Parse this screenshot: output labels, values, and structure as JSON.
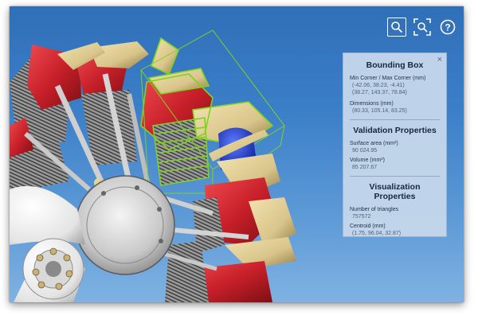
{
  "toolbar": {
    "buttons": [
      {
        "name": "zoom-window-button",
        "icon": "magnifier-icon"
      },
      {
        "name": "zoom-fit-button",
        "icon": "zoom-extents-icon"
      },
      {
        "name": "help-button",
        "icon": "question-mark-icon"
      }
    ]
  },
  "panel": {
    "close_icon": "×",
    "bounding_box": {
      "title": "Bounding Box",
      "min_max_label": "Min Corner / Max Corner (mm)",
      "min_corner": "(-42.06, 38.23, -4.41)",
      "max_corner": "(38.27, 143.37, 78.84)",
      "dimensions_label": "Dimensions (mm)",
      "dimensions": "(80.33, 105.14, 83.25)"
    },
    "validation": {
      "title": "Validation Properties",
      "surface_label": "Surface area (mm²)",
      "surface_value": "90 024.95",
      "volume_label": "Volume (mm³)",
      "volume_value": "85 207.67"
    },
    "visualization": {
      "title": "Visualization Properties",
      "triangles_label": "Number of triangles",
      "triangles_value": "757572",
      "centroid_label": "Centroid (mm)",
      "centroid_value": "(1.75, 96.04, 32.87)"
    }
  },
  "colors": {
    "background_top": "#2f6fb8",
    "background_bottom": "#7fb2e2",
    "cylinder_red": "#c8202a",
    "brass": "#d9c58a",
    "selection_green": "#7ed321",
    "highlight_blue": "#1a3fd0"
  }
}
